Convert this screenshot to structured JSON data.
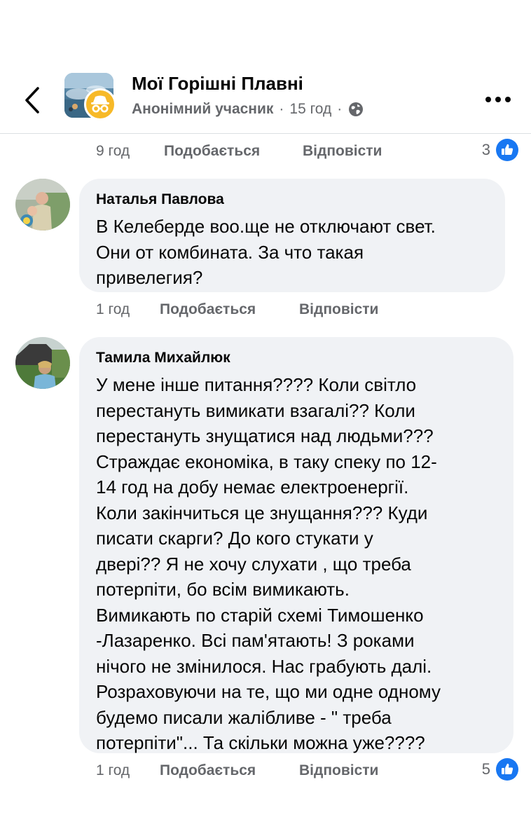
{
  "header": {
    "group_name": "Мої Горішні Плавні",
    "author": "Анонімний учасник",
    "separator": "·",
    "time": "15 год",
    "privacy_icon": "globe-icon",
    "back_icon": "chevron-left-icon",
    "more_icon": "more-dots-icon"
  },
  "actions": {
    "like_label": "Подобається",
    "reply_label": "Відповісти"
  },
  "previous_comment": {
    "time": "9 год",
    "reactions": "3"
  },
  "comments": [
    {
      "author": "Наталья Павлова",
      "text": "В Келеберде воо.ще не отключают свет.\nОни от комбината. За что такая\nпривелегия?",
      "time": "1 год"
    },
    {
      "author": "Тамила Михайлюк",
      "text": "У мене інше питання???? Коли світло\nперестануть вимикати взагалі?? Коли\nперестануть знущатися над людьми???\nСтраждає економіка, в таку спеку по 12-\n14 год на добу немає електроенергії.\nКоли закінчиться це знущання??? Куди\nписати скарги? До кого стукати у\nдвері?? Я не хочу слухати , що треба\nпотерпіти, бо всім вимикають.\nВимикають по старій схемі Тимошенко\n-Лазаренко. Всі пам'ятають! З роками\nнічого не змінилося. Нас грабують далі.\nРозраховуючи на те, що ми одне одному\nбудемо писали жалібливе - \" треба\nпотерпіти\"... Та скільки можна уже????",
      "time": "1 год",
      "reactions": "5"
    }
  ],
  "colors": {
    "bubble": "#f0f2f5",
    "meta": "#65676b",
    "like_blue": "#1877f2",
    "anon_badge": "#f7b928"
  }
}
